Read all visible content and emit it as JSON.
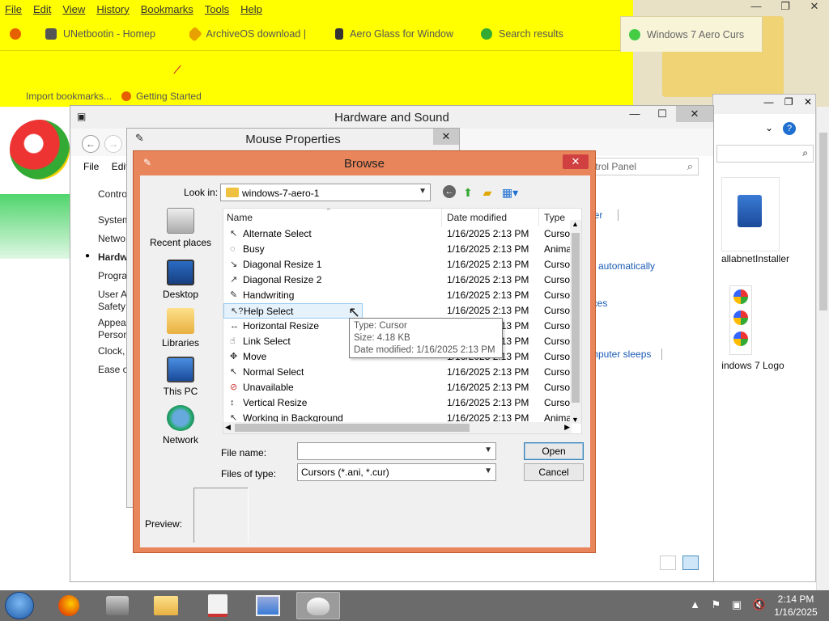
{
  "firefox": {
    "menu": [
      "File",
      "Edit",
      "View",
      "History",
      "Bookmarks",
      "Tools",
      "Help"
    ],
    "tabs": [
      {
        "label": "UNetbootin - Homep"
      },
      {
        "label": "ArchiveOS download |"
      },
      {
        "label": "Aero Glass for Window"
      },
      {
        "label": "Search results"
      },
      {
        "label": "Windows 7 Aero Curs"
      }
    ],
    "bookmarks": [
      "Import bookmarks...",
      "Getting Started"
    ]
  },
  "desktop_items": [
    {
      "label": "allabnetInstaller"
    },
    {
      "label": "indows 7 Logo"
    }
  ],
  "hardware_sound": {
    "title": "Hardware and Sound",
    "search_placeholder": "Search Control Panel",
    "menu": [
      "File",
      "Edit"
    ],
    "left_nav": [
      "Contro",
      "System",
      "Netwo",
      "Hardw",
      "Progra",
      "User A",
      "Safety",
      "Appea",
      "Person",
      "Clock,",
      "Ease o"
    ],
    "links": [
      "ger",
      "e automatically",
      "ices",
      "mputer sleeps"
    ]
  },
  "mouse_properties": {
    "title": "Mouse Properties"
  },
  "browse": {
    "title": "Browse",
    "look_in_label": "Look in:",
    "look_in_value": "windows-7-aero-1",
    "places": [
      "Recent places",
      "Desktop",
      "Libraries",
      "This PC",
      "Network"
    ],
    "columns": [
      "Name",
      "Date modified",
      "Type"
    ],
    "files": [
      {
        "name": "Alternate Select",
        "date": "1/16/2025 2:13 PM",
        "type": "Cursor",
        "icon": "↖"
      },
      {
        "name": "Busy",
        "date": "1/16/2025 2:13 PM",
        "type": "Anima",
        "icon": "◌"
      },
      {
        "name": "Diagonal Resize 1",
        "date": "1/16/2025 2:13 PM",
        "type": "Cursor",
        "icon": "↘"
      },
      {
        "name": "Diagonal Resize 2",
        "date": "1/16/2025 2:13 PM",
        "type": "Cursor",
        "icon": "↗"
      },
      {
        "name": "Handwriting",
        "date": "1/16/2025 2:13 PM",
        "type": "Cursor",
        "icon": "✎"
      },
      {
        "name": "Help Select",
        "date": "1/16/2025 2:13 PM",
        "type": "Cursor",
        "icon": "↖?"
      },
      {
        "name": "Horizontal Resize",
        "date": "1/16/2025 2:13 PM",
        "type": "Cursor",
        "icon": "↔"
      },
      {
        "name": "Link Select",
        "date": "1/16/2025 2:13 PM",
        "type": "Cursor",
        "icon": "☝"
      },
      {
        "name": "Move",
        "date": "1/16/2025 2:13 PM",
        "type": "Cursor",
        "icon": "✥"
      },
      {
        "name": "Normal Select",
        "date": "1/16/2025 2:13 PM",
        "type": "Cursor",
        "icon": "↖"
      },
      {
        "name": "Unavailable",
        "date": "1/16/2025 2:13 PM",
        "type": "Cursor",
        "icon": "⊘"
      },
      {
        "name": "Vertical Resize",
        "date": "1/16/2025 2:13 PM",
        "type": "Cursor",
        "icon": "↕"
      },
      {
        "name": "Working in Background",
        "date": "1/16/2025 2:13 PM",
        "type": "Anima",
        "icon": "↖"
      }
    ],
    "tooltip": {
      "type": "Type: Cursor",
      "size": "Size: 4.18 KB",
      "date": "Date modified: 1/16/2025 2:13 PM"
    },
    "file_name_label": "File name:",
    "file_name_value": "",
    "files_of_type_label": "Files of type:",
    "files_of_type_value": "Cursors (*.ani, *.cur)",
    "open_label": "Open",
    "cancel_label": "Cancel",
    "preview_label": "Preview:"
  },
  "taskbar": {
    "time": "2:14 PM",
    "date": "1/16/2025"
  }
}
